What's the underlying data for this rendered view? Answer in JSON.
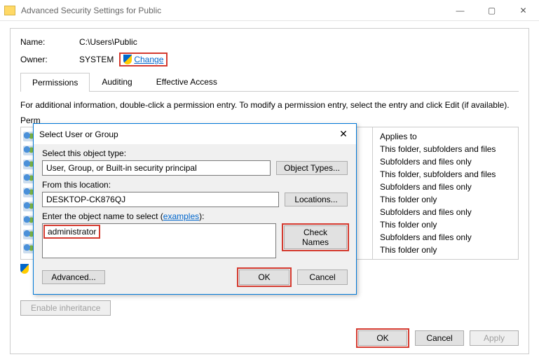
{
  "window": {
    "title": "Advanced Security Settings for Public"
  },
  "fields": {
    "nameLabel": "Name:",
    "nameValue": "C:\\Users\\Public",
    "ownerLabel": "Owner:",
    "ownerValue": "SYSTEM",
    "changeLink": "Change"
  },
  "tabs": {
    "permissions": "Permissions",
    "auditing": "Auditing",
    "effective": "Effective Access"
  },
  "info": "For additional information, double-click a permission entry. To modify a permission entry, select the entry and click Edit (if available).",
  "permHeader": "Perm",
  "applies": {
    "header": "Applies to",
    "rows": [
      "This folder, subfolders and files",
      "Subfolders and files only",
      "This folder, subfolders and files",
      "Subfolders and files only",
      "This folder only",
      "Subfolders and files only",
      "This folder only",
      "Subfolders and files only",
      "This folder only"
    ]
  },
  "buttons": {
    "enableInheritance": "Enable inheritance",
    "ok": "OK",
    "cancel": "Cancel",
    "apply": "Apply"
  },
  "dialog": {
    "title": "Select User or Group",
    "objectTypeLabel": "Select this object type:",
    "objectTypeValue": "User, Group, or Built-in security principal",
    "objectTypesBtn": "Object Types...",
    "locationLabel": "From this location:",
    "locationValue": "DESKTOP-CK876QJ",
    "locationsBtn": "Locations...",
    "enterLabel": "Enter the object name to select (",
    "examples": "examples",
    "enterLabelEnd": "):",
    "objectName": "administrator",
    "checkNames": "Check Names",
    "advanced": "Advanced...",
    "ok": "OK",
    "cancel": "Cancel"
  }
}
